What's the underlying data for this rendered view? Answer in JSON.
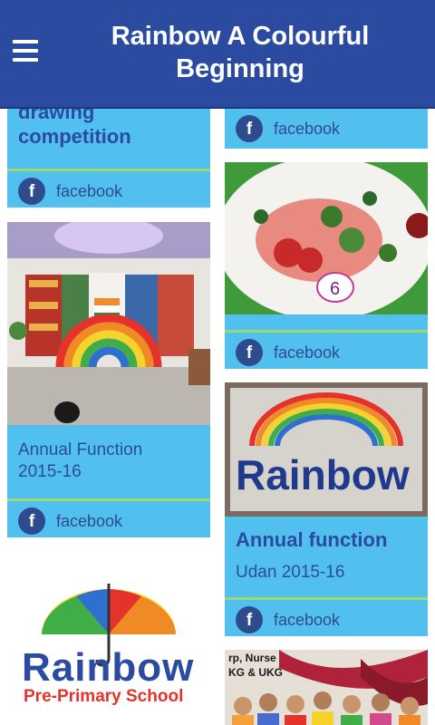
{
  "header": {
    "title_line1": "Rainbow A Colourful",
    "title_line2": "Beginning"
  },
  "cards": {
    "left1": {
      "title_line1": "drawing",
      "title_line2": "competition",
      "share": "facebook"
    },
    "left2": {
      "title_line1": "Annual Function",
      "title_line2": "2015-16",
      "share": "facebook"
    },
    "left3": {
      "logo_word": "Rainbow",
      "logo_sub": "Pre-Primary School"
    },
    "right1": {
      "share": "facebook"
    },
    "right2": {
      "share": "facebook"
    },
    "right3": {
      "title": "Annual function",
      "subtitle": "Udan 2015-16",
      "share": "facebook",
      "image_text": "Rainbow"
    },
    "right4": {
      "banner_line1": "rp, Nurse",
      "banner_line2": "KG & UKG"
    }
  },
  "icons": {
    "menu": "hamburger-menu-icon",
    "share": "facebook-icon"
  },
  "colors": {
    "appbar": "#2b4ba0",
    "card": "#52c0ee",
    "divider": "#9bd86e",
    "text": "#2b4ba0"
  }
}
